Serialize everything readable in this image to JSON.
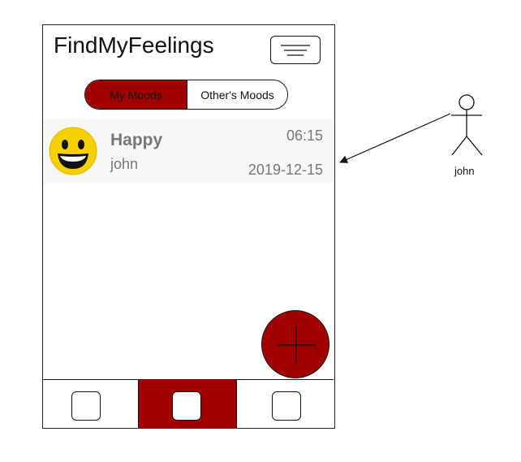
{
  "app": {
    "title": "FindMyFeelings"
  },
  "header": {
    "menu_icon": "hamburger-menu-icon"
  },
  "toggle": {
    "my_moods": "My Moods",
    "others_moods": "Other's Moods",
    "selected": "My Moods"
  },
  "mood_entry": {
    "mood": "Happy",
    "user": "john",
    "time": "06:15",
    "date": "2019-12-15",
    "icon": "happy-face-icon"
  },
  "fab": {
    "icon": "plus-icon"
  },
  "bottom_nav": {
    "tabs": [
      {
        "icon": "square-icon",
        "active": false
      },
      {
        "icon": "square-icon",
        "active": true
      },
      {
        "icon": "square-icon",
        "active": false
      }
    ]
  },
  "actor": {
    "label": "john",
    "icon": "stick-figure-icon"
  },
  "colors": {
    "accent": "#a00000",
    "card_bg": "#f7f7f7",
    "text_muted": "#777777"
  }
}
